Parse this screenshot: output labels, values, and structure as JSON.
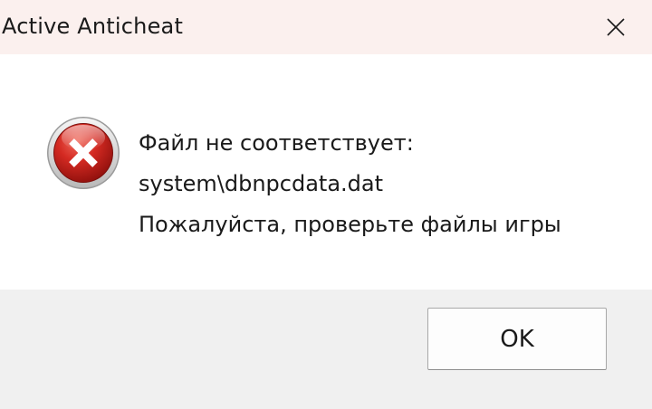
{
  "window": {
    "title": "Active Anticheat",
    "close_icon": "close-x-icon"
  },
  "dialog": {
    "icon": "error-icon",
    "icon_color": "#c8211f",
    "message_lines": [
      "Файл не соответствует:",
      "system\\dbnpcdata.dat",
      "Пожалуйста, проверьте файлы игры"
    ]
  },
  "buttons": {
    "ok_label": "OK"
  }
}
